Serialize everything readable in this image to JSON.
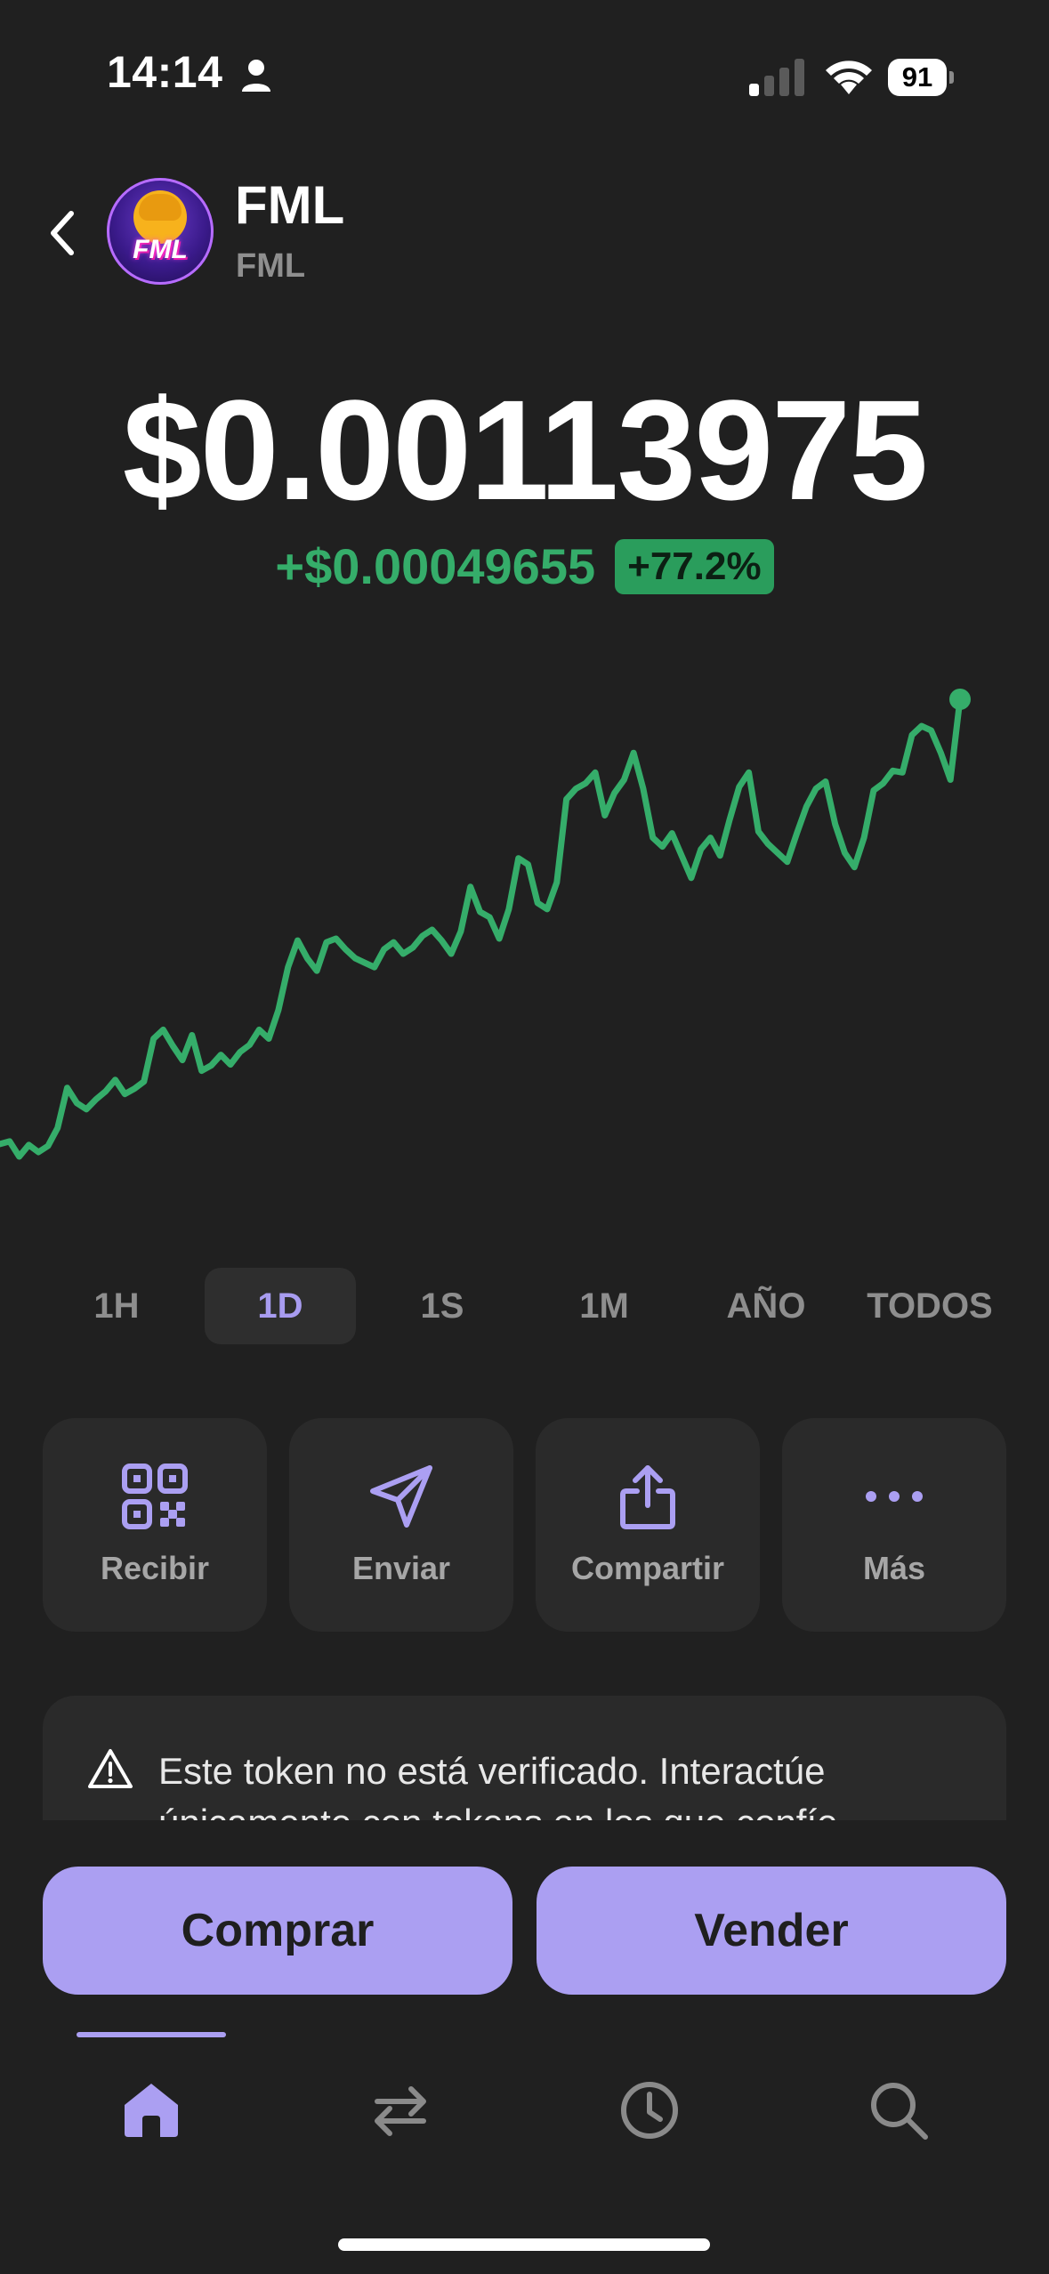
{
  "status_bar": {
    "time": "14:14",
    "battery": "91"
  },
  "header": {
    "token_name": "FML",
    "token_symbol": "FML",
    "logo_text": "FML"
  },
  "price": {
    "value": "$0.00113975",
    "change_abs": "+$0.00049655",
    "change_pct": "+77.2%"
  },
  "colors": {
    "accent": "#ab9ff2",
    "positive": "#35ad6a",
    "background": "#202020",
    "card": "#2a2a2a"
  },
  "chart_data": {
    "type": "line",
    "series": [
      {
        "values": [
          0.000642,
          0.000645,
          0.000628,
          0.000641,
          0.000633,
          0.00064,
          0.00066,
          0.000705,
          0.000688,
          0.000681,
          0.000692,
          0.000701,
          0.000714,
          0.000698,
          0.000704,
          0.000712,
          0.00076,
          0.00077,
          0.000752,
          0.000736,
          0.000764,
          0.000724,
          0.00073,
          0.000742,
          0.000731,
          0.000745,
          0.000753,
          0.00077,
          0.00076,
          0.000792,
          0.00084,
          0.00087,
          0.00085,
          0.000836,
          0.000868,
          0.000872,
          0.00086,
          0.00085,
          0.000845,
          0.00084,
          0.00086,
          0.000868,
          0.000855,
          0.000862,
          0.000875,
          0.000882,
          0.00087,
          0.000855,
          0.00088,
          0.00093,
          0.000902,
          0.000896,
          0.000872,
          0.000905,
          0.000962,
          0.000955,
          0.000912,
          0.000905,
          0.000935,
          0.001028,
          0.00104,
          0.001046,
          0.001058,
          0.00101,
          0.001035,
          0.00105,
          0.00108,
          0.00104,
          0.000985,
          0.000975,
          0.00099,
          0.000965,
          0.00094,
          0.000972,
          0.000985,
          0.000965,
          0.001005,
          0.001042,
          0.001058,
          0.000992,
          0.000978,
          0.000968,
          0.000958,
          0.00099,
          0.00102,
          0.00104,
          0.001048,
          0.001,
          0.000968,
          0.000952,
          0.000985,
          0.001038,
          0.001046,
          0.00106,
          0.001058,
          0.0011,
          0.00111,
          0.001105,
          0.00108,
          0.00105,
          0.00114
        ]
      }
    ],
    "grid": false,
    "end_marker": true
  },
  "timeframes": [
    {
      "label": "1H",
      "active": false
    },
    {
      "label": "1D",
      "active": true
    },
    {
      "label": "1S",
      "active": false
    },
    {
      "label": "1M",
      "active": false
    },
    {
      "label": "AÑO",
      "active": false
    },
    {
      "label": "TODOS",
      "active": false
    }
  ],
  "actions": [
    {
      "label": "Recibir",
      "icon": "qr-code-icon"
    },
    {
      "label": "Enviar",
      "icon": "send-icon"
    },
    {
      "label": "Compartir",
      "icon": "share-icon"
    },
    {
      "label": "Más",
      "icon": "more-icon"
    }
  ],
  "warning": {
    "text": "Este token no está verificado. Interactúe únicamente con tokens en los que confíe."
  },
  "buttons": {
    "buy": "Comprar",
    "sell": "Vender"
  },
  "nav": [
    {
      "icon": "home-icon",
      "active": true
    },
    {
      "icon": "swap-icon",
      "active": false
    },
    {
      "icon": "history-icon",
      "active": false
    },
    {
      "icon": "search-icon",
      "active": false
    }
  ]
}
